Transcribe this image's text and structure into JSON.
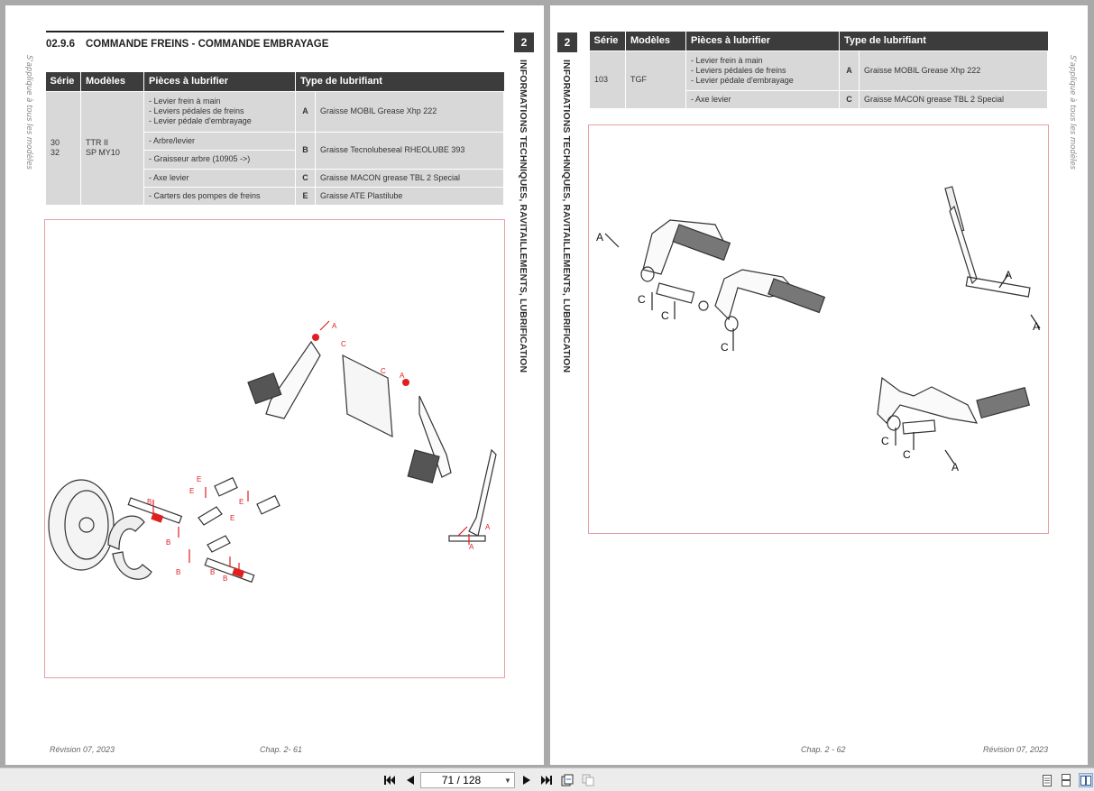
{
  "left_page": {
    "side_note": "S'applique à tous les modèles",
    "chapter_num": "2",
    "chapter_label": "INFORMATIONS TECHNIQUES, RAVITAILLEMENTS, LUBRIFICATION",
    "section_num": "02.9.6",
    "section_title": "COMMANDE FREINS - COMMANDE EMBRAYAGE",
    "table": {
      "headers": [
        "Série",
        "Modèles",
        "Pièces à lubrifier",
        "Type de lubrifiant"
      ],
      "serie": "30\n32",
      "modeles": "TTR II\nSP MY10",
      "rows": [
        {
          "parts": [
            "- Levier frein à main",
            "- Leviers pédales de freins",
            "- Levier pédale d'embrayage"
          ],
          "code": "A",
          "lubricant": "Graisse MOBIL Grease Xhp 222"
        },
        {
          "parts": [
            "- Arbre/levier"
          ],
          "code": "B",
          "lubricant": "Graisse Tecnolubeseal RHEOLUBE 393"
        },
        {
          "parts": [
            "- Graisseur arbre (10905 ->)"
          ]
        },
        {
          "parts": [
            "- Axe levier"
          ],
          "code": "C",
          "lubricant": "Graisse MACON grease TBL 2 Special"
        },
        {
          "parts": [
            "- Carters des pompes de freins"
          ],
          "code": "E",
          "lubricant": "Graisse ATE Plastilube"
        }
      ]
    },
    "diagram_labels": {
      "A": "A",
      "B": "B",
      "C": "C",
      "E": "E"
    },
    "footer_revision": "Révision 07, 2023",
    "footer_chapter": "Chap. 2- 61"
  },
  "right_page": {
    "side_note": "S'applique à tous les modèles",
    "chapter_num": "2",
    "chapter_label": "INFORMATIONS TECHNIQUES, RAVITAILLEMENTS, LUBRIFICATION",
    "table": {
      "headers": [
        "Série",
        "Modèles",
        "Pièces à lubrifier",
        "Type de lubrifiant"
      ],
      "serie": "103",
      "modeles": "TGF",
      "rows": [
        {
          "parts": [
            "- Levier frein à main",
            "- Leviers pédales de freins",
            "- Levier pédale d'embrayage"
          ],
          "code": "A",
          "lubricant": "Graisse MOBIL Grease Xhp 222"
        },
        {
          "parts": [
            "- Axe levier"
          ],
          "code": "C",
          "lubricant": "Graisse MACON grease TBL 2 Special"
        }
      ]
    },
    "diagram_labels": {
      "A": "A",
      "C": "C"
    },
    "footer_chapter": "Chap. 2 - 62",
    "footer_revision": "Révision 07, 2023"
  },
  "toolbar": {
    "page_value": "71 / 128",
    "icons": [
      "first-page-icon",
      "prev-page-icon",
      "next-page-icon",
      "last-page-icon",
      "rotate-icon",
      "compare-icon",
      "single-page-icon",
      "continuous-page-icon",
      "two-page-icon"
    ]
  },
  "colors": {
    "header_bg": "#3c3c3c",
    "cell_bg": "#d8d8d8",
    "lube_arrow": "#e02020",
    "frame": "#e3a0a6"
  }
}
